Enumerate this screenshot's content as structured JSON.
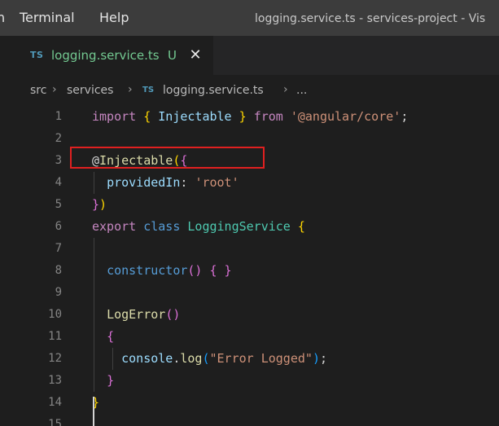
{
  "menubar": {
    "clipped_left": "n",
    "items": [
      "Terminal",
      "Help"
    ],
    "window_title": "logging.service.ts - services-project - Vis"
  },
  "tab": {
    "icon": "TS",
    "filename": "logging.service.ts",
    "status": "U",
    "close_glyph": "✕"
  },
  "breadcrumb": {
    "items": [
      "src",
      "services",
      "logging.service.ts",
      "..."
    ],
    "separator": "›",
    "file_icon": "TS"
  },
  "editor": {
    "highlighted_line": 3,
    "lines": [
      {
        "n": "1",
        "tokens": [
          {
            "t": "import",
            "c": "keyword"
          },
          {
            "t": " ",
            "c": "plain"
          },
          {
            "t": "{",
            "c": "brace-gold"
          },
          {
            "t": " Injectable ",
            "c": "prop"
          },
          {
            "t": "}",
            "c": "brace-gold"
          },
          {
            "t": " ",
            "c": "plain"
          },
          {
            "t": "from",
            "c": "keyword"
          },
          {
            "t": " ",
            "c": "plain"
          },
          {
            "t": "'@angular/core'",
            "c": "string"
          },
          {
            "t": ";",
            "c": "plain"
          }
        ]
      },
      {
        "n": "2",
        "tokens": []
      },
      {
        "n": "3",
        "tokens": [
          {
            "t": "@",
            "c": "plain"
          },
          {
            "t": "Injectable",
            "c": "func"
          },
          {
            "t": "(",
            "c": "brace-gold"
          },
          {
            "t": "{",
            "c": "brace-purple"
          }
        ]
      },
      {
        "n": "4",
        "tokens": [
          {
            "t": "  ",
            "c": "plain"
          },
          {
            "t": "providedIn",
            "c": "prop"
          },
          {
            "t": ": ",
            "c": "plain"
          },
          {
            "t": "'root'",
            "c": "string"
          }
        ]
      },
      {
        "n": "5",
        "tokens": [
          {
            "t": "}",
            "c": "brace-purple"
          },
          {
            "t": ")",
            "c": "brace-gold"
          }
        ]
      },
      {
        "n": "6",
        "tokens": [
          {
            "t": "export",
            "c": "keyword"
          },
          {
            "t": " ",
            "c": "plain"
          },
          {
            "t": "class",
            "c": "blue"
          },
          {
            "t": " ",
            "c": "plain"
          },
          {
            "t": "LoggingService",
            "c": "class"
          },
          {
            "t": " ",
            "c": "plain"
          },
          {
            "t": "{",
            "c": "brace-gold"
          }
        ]
      },
      {
        "n": "7",
        "tokens": []
      },
      {
        "n": "8",
        "tokens": [
          {
            "t": "  ",
            "c": "plain"
          },
          {
            "t": "constructor",
            "c": "blue"
          },
          {
            "t": "()",
            "c": "brace-purple"
          },
          {
            "t": " ",
            "c": "plain"
          },
          {
            "t": "{ }",
            "c": "brace-purple"
          }
        ]
      },
      {
        "n": "9",
        "tokens": []
      },
      {
        "n": "10",
        "tokens": [
          {
            "t": "  ",
            "c": "plain"
          },
          {
            "t": "LogError",
            "c": "func"
          },
          {
            "t": "()",
            "c": "brace-purple"
          }
        ]
      },
      {
        "n": "11",
        "tokens": [
          {
            "t": "  ",
            "c": "plain"
          },
          {
            "t": "{",
            "c": "brace-purple"
          }
        ]
      },
      {
        "n": "12",
        "tokens": [
          {
            "t": "    ",
            "c": "plain"
          },
          {
            "t": "console",
            "c": "prop"
          },
          {
            "t": ".",
            "c": "plain"
          },
          {
            "t": "log",
            "c": "func"
          },
          {
            "t": "(",
            "c": "brace-blue"
          },
          {
            "t": "\"Error Logged\"",
            "c": "string"
          },
          {
            "t": ")",
            "c": "brace-blue"
          },
          {
            "t": ";",
            "c": "plain"
          }
        ]
      },
      {
        "n": "13",
        "tokens": [
          {
            "t": "  ",
            "c": "plain"
          },
          {
            "t": "}",
            "c": "brace-purple"
          }
        ]
      },
      {
        "n": "14",
        "tokens": [
          {
            "t": "}",
            "c": "brace-gold"
          }
        ]
      },
      {
        "n": "15",
        "tokens": []
      }
    ]
  },
  "colors": {
    "titlebar_bg": "#3c3c3c",
    "editor_bg": "#1e1e1e",
    "untracked_file": "#73c991",
    "highlight_border": "#e02020"
  }
}
